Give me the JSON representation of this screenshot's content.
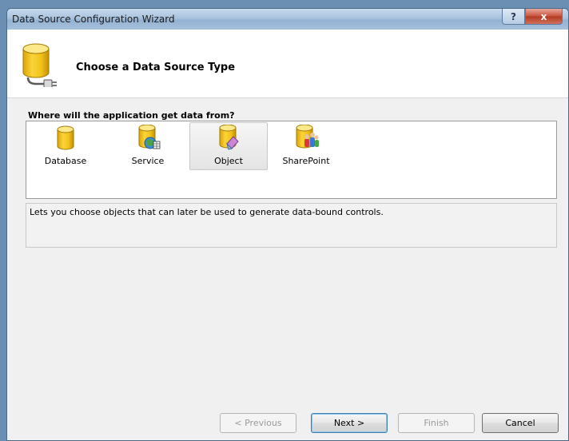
{
  "window": {
    "title": "Data Source Configuration Wizard",
    "help_label": "?",
    "close_label": "x"
  },
  "header": {
    "title": "Choose a Data Source Type",
    "icon": "database-plug-icon"
  },
  "prompt": "Where will the application get data from?",
  "data_source_types": [
    {
      "label": "Database",
      "icon": "database-icon",
      "selected": false
    },
    {
      "label": "Service",
      "icon": "service-icon",
      "selected": false
    },
    {
      "label": "Object",
      "icon": "object-icon",
      "selected": true
    },
    {
      "label": "SharePoint",
      "icon": "sharepoint-icon",
      "selected": false
    }
  ],
  "description": "Lets you choose objects that can later be used to generate data-bound controls.",
  "buttons": {
    "previous": "< Previous",
    "next": "Next >",
    "finish": "Finish",
    "cancel": "Cancel"
  },
  "colors": {
    "cylinder_fill": "#f2c21a",
    "cylinder_top": "#fde88a",
    "cylinder_stroke": "#a27a06"
  }
}
